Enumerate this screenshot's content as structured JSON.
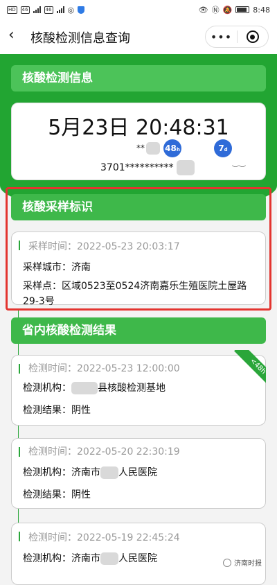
{
  "status_bar": {
    "left_chips": [
      "HD",
      "46",
      "46"
    ],
    "time": "8:48"
  },
  "nav": {
    "title": "核酸检测信息查询",
    "more_icon": "more-dots-icon",
    "close_icon": "target-circle-icon"
  },
  "test_info": {
    "header": "核酸检测信息",
    "datetime": "5月23日 20:48:31",
    "name_masked": "**",
    "badge_48": "48",
    "badge_48_sub": "h",
    "badge_7": "7",
    "badge_7_sub": "d",
    "id_number": "3701**********"
  },
  "sampling": {
    "header": "核酸采样标识",
    "time_label": "采样时间：",
    "time_value": "2022-05-23 20:03:17",
    "city_label": "采样城市：",
    "city_value": "济南",
    "site_label": "采样点：",
    "site_value": "区域0523至0524济南嘉乐生殖医院土屋路29-3号"
  },
  "results": {
    "header": "省内核酸检测结果",
    "ribbon": "<48h",
    "items": [
      {
        "time_label": "检测时间：",
        "time": "2022-05-23 12:00:00",
        "org_label": "检测机构：",
        "org": "县核酸检测基地",
        "result_label": "检测结果：",
        "result": "阴性"
      },
      {
        "time_label": "检测时间：",
        "time": "2022-05-20 22:30:19",
        "org_label": "检测机构：",
        "org_prefix": "济南市",
        "org": "人民医院",
        "result_label": "检测结果：",
        "result": "阴性"
      },
      {
        "time_label": "检测时间：",
        "time": "2022-05-19 22:45:24",
        "org_label": "检测机构：",
        "org_prefix": "济南市",
        "org": "人民医院"
      }
    ]
  },
  "watermark": "济南时报",
  "colors": {
    "green": "#22a532",
    "red_box": "#e3342f",
    "badge_blue": "#2f6bd8"
  }
}
